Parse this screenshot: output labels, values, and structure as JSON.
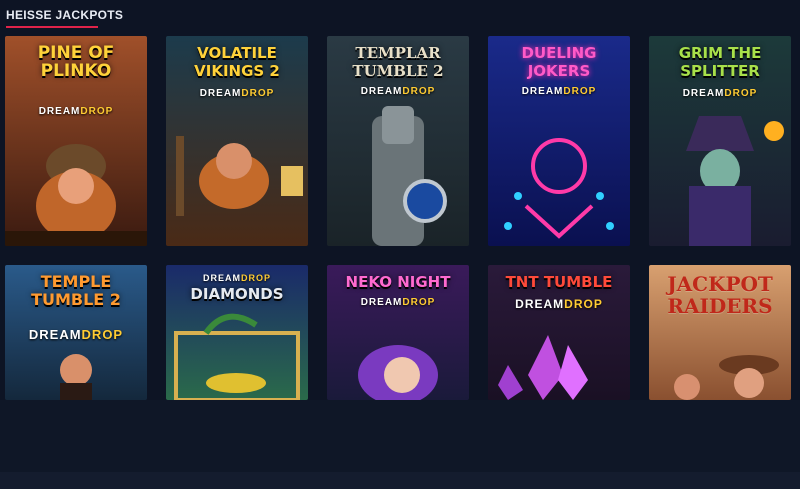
{
  "section": {
    "title": "HEISSE JACKPOTS"
  },
  "tiles": [
    {
      "name": "PINE OF PLINKO",
      "dream": "DREAM",
      "drop": "DROP"
    },
    {
      "name": "VOLATILE VIKINGS 2",
      "dream": "DREAM",
      "drop": "DROP"
    },
    {
      "name": "TEMPLAR TUMBLE 2",
      "dream": "DREAM",
      "drop": "DROP"
    },
    {
      "name": "DUELING JOKERS",
      "dream": "DREAM",
      "drop": "DROP"
    },
    {
      "name": "GRIM THE SPLITTER",
      "dream": "DREAM",
      "drop": "DROP"
    },
    {
      "name": "TEMPLE TUMBLE 2",
      "dream": "DREAM",
      "drop": "DROP"
    },
    {
      "name": "DIAMONDS",
      "dream": "DREAM",
      "drop": "DROP"
    },
    {
      "name": "NEKO NIGHT",
      "dream": "DREAM",
      "drop": "DROP"
    },
    {
      "name": "TNT TUMBLE",
      "dream": "DREAM",
      "drop": "DROP"
    },
    {
      "name": "JACKPOT RAIDERS",
      "dream": "",
      "drop": ""
    }
  ],
  "colors": {
    "accent": "#e0234a",
    "background": "#0d1424"
  }
}
